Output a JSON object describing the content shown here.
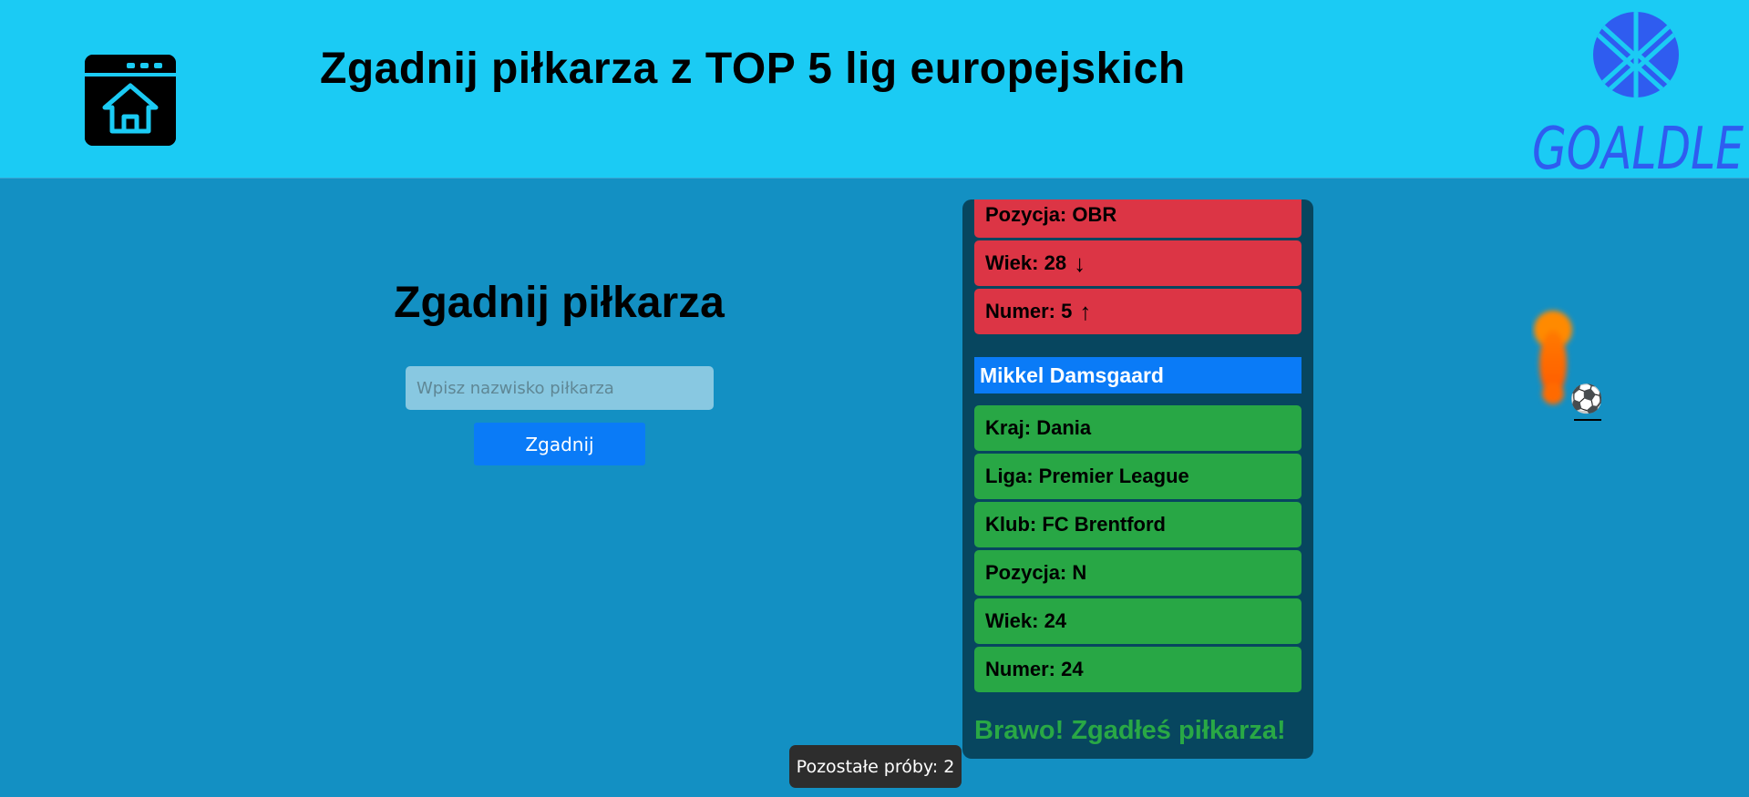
{
  "header": {
    "title": "Zgadnij piłkarza z TOP 5 lig europejskich",
    "logo_text": "GOALDLE"
  },
  "form": {
    "heading": "Zgadnij piłkarza",
    "input_placeholder": "Wpisz nazwisko piłkarza",
    "input_value": "",
    "button_label": "Zgadnij"
  },
  "previous_guess": {
    "rows": [
      {
        "label": "Pozycja: OBR",
        "arrow": "",
        "status": "wrong"
      },
      {
        "label": "Wiek: 28",
        "arrow": "↓",
        "status": "wrong"
      },
      {
        "label": "Numer: 5",
        "arrow": "↑",
        "status": "wrong"
      }
    ]
  },
  "current_guess": {
    "player_name": "Mikkel Damsgaard",
    "rows": [
      {
        "label": "Kraj: Dania",
        "status": "correct"
      },
      {
        "label": "Liga: Premier League",
        "status": "correct"
      },
      {
        "label": "Klub: FC Brentford",
        "status": "correct"
      },
      {
        "label": "Pozycja: N",
        "status": "correct"
      },
      {
        "label": "Wiek: 24",
        "status": "correct"
      },
      {
        "label": "Numer: 24",
        "status": "correct"
      }
    ]
  },
  "result_message": "Brawo! Zgadłeś piłkarza!",
  "toast": {
    "text": "Pozostałe próby: 2"
  },
  "icons": {
    "home": "home-icon",
    "logo": "goaldle-logo-icon",
    "ball": "⚽"
  },
  "colors": {
    "header_bg": "#1bcbf4",
    "page_bg": "#1390c3",
    "panel_bg": "#07465f",
    "wrong": "#dc3545",
    "correct": "#28a745",
    "accent": "#0a7bf7",
    "success_text": "#29a845"
  }
}
